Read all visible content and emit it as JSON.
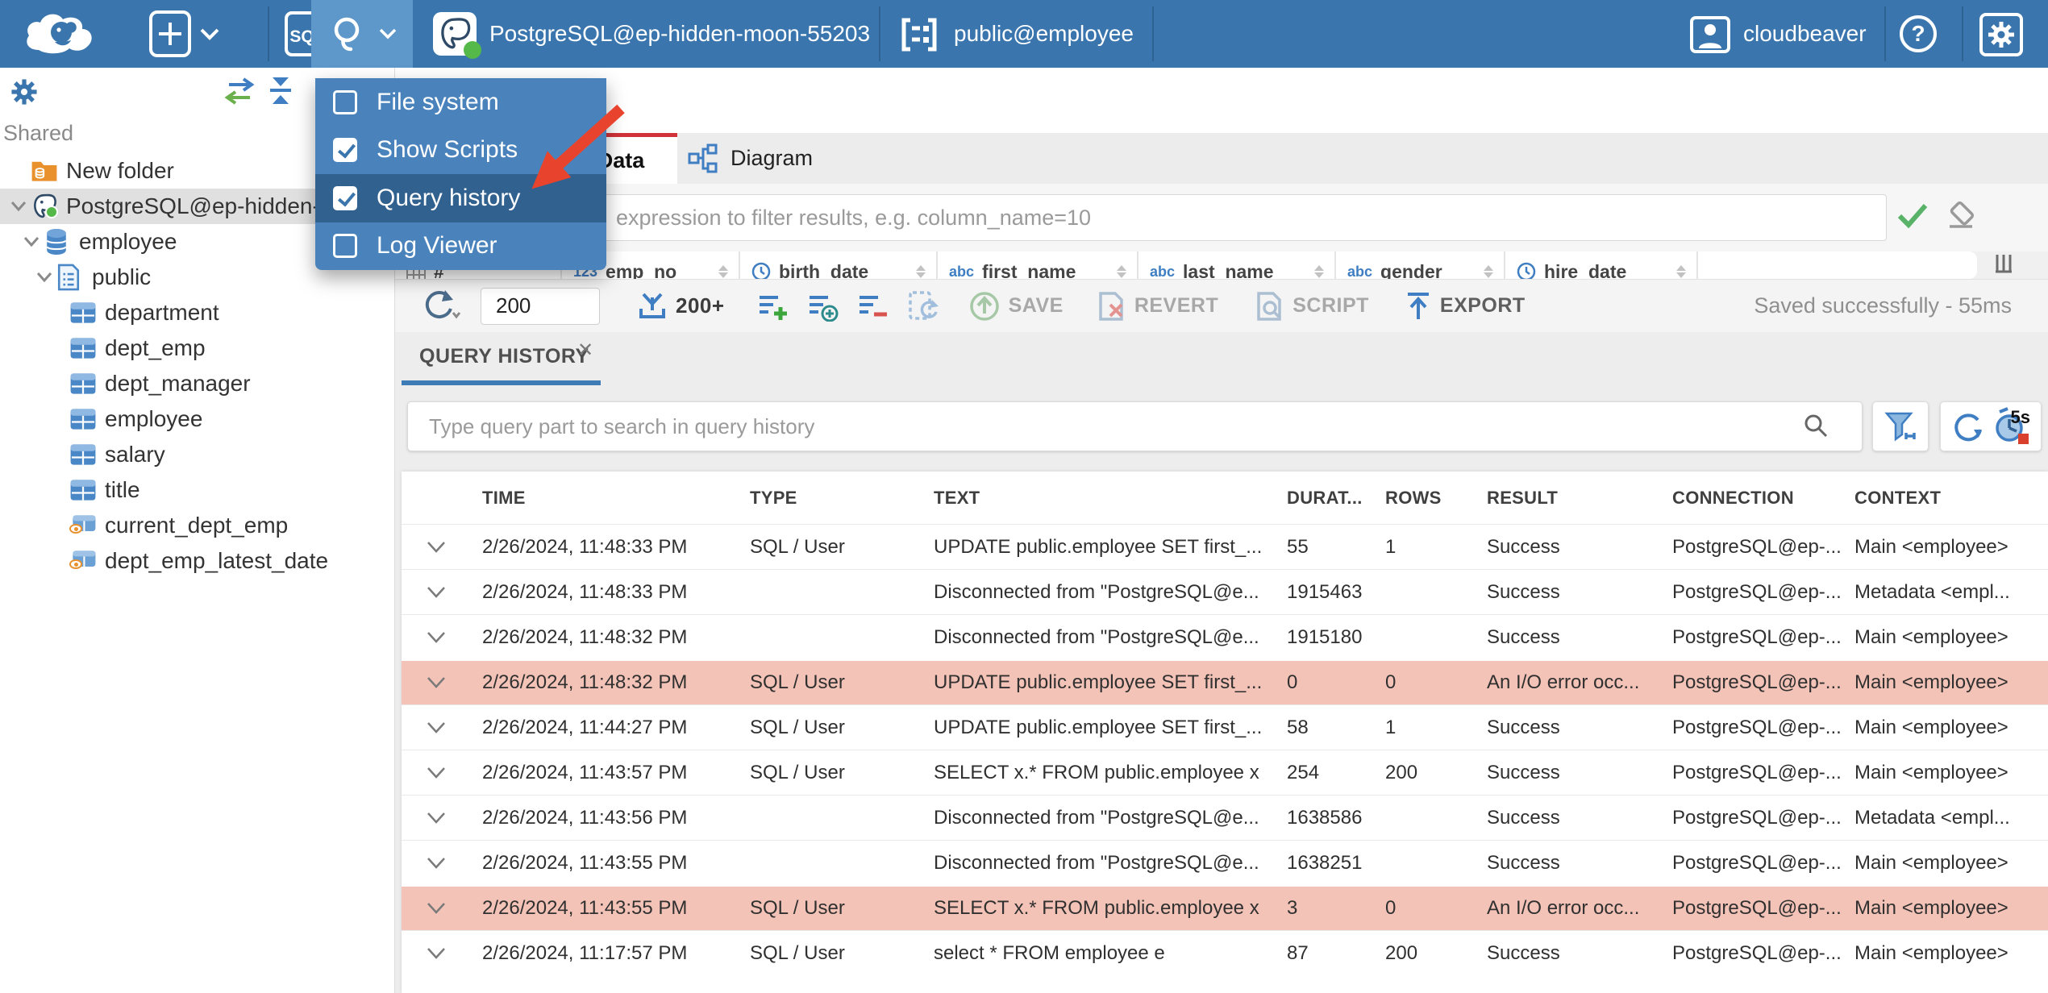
{
  "topbar": {
    "connection_name": "PostgreSQL@ep-hidden-moon-55203",
    "schema_name": "public@employee",
    "sql_label": "SQL",
    "user_name": "cloudbeaver"
  },
  "tools_menu": {
    "items": [
      {
        "label": "File system",
        "checked": false,
        "highlighted": false
      },
      {
        "label": "Show Scripts",
        "checked": true,
        "highlighted": false
      },
      {
        "label": "Query history",
        "checked": true,
        "highlighted": true
      },
      {
        "label": "Log Viewer",
        "checked": false,
        "highlighted": false
      }
    ]
  },
  "sidebar": {
    "section_label": "Shared",
    "tree": [
      {
        "label": "New folder",
        "icon": "folder",
        "level": 1,
        "chevron": false,
        "selected": false
      },
      {
        "label": "PostgreSQL@ep-hidden-",
        "icon": "postgres",
        "level": 1,
        "chevron": true,
        "selected": true
      },
      {
        "label": "employee",
        "icon": "database",
        "level": 2,
        "chevron": true,
        "selected": false
      },
      {
        "label": "public",
        "icon": "schema",
        "level": 3,
        "chevron": true,
        "selected": false
      },
      {
        "label": "department",
        "icon": "table",
        "level": 4,
        "chevron": false,
        "selected": false
      },
      {
        "label": "dept_emp",
        "icon": "table",
        "level": 4,
        "chevron": false,
        "selected": false
      },
      {
        "label": "dept_manager",
        "icon": "table",
        "level": 4,
        "chevron": false,
        "selected": false
      },
      {
        "label": "employee",
        "icon": "table",
        "level": 4,
        "chevron": false,
        "selected": false
      },
      {
        "label": "salary",
        "icon": "table",
        "level": 4,
        "chevron": false,
        "selected": false
      },
      {
        "label": "title",
        "icon": "table",
        "level": 4,
        "chevron": false,
        "selected": false
      },
      {
        "label": "current_dept_emp",
        "icon": "view",
        "level": 4,
        "chevron": false,
        "selected": false
      },
      {
        "label": "dept_emp_latest_date",
        "icon": "view",
        "level": 4,
        "chevron": false,
        "selected": false
      }
    ]
  },
  "main": {
    "tabs": [
      {
        "label": "Data",
        "active": true
      },
      {
        "label": "Diagram",
        "active": false
      }
    ],
    "filter_placeholder": "expression to filter results, e.g. column_name=10",
    "grid_columns": [
      {
        "glyph": "rownum",
        "label": "#"
      },
      {
        "glyph": "123",
        "label": "emp_no"
      },
      {
        "glyph": "clock",
        "label": "birth_date"
      },
      {
        "glyph": "abc",
        "label": "first_name"
      },
      {
        "glyph": "abc",
        "label": "last_name"
      },
      {
        "glyph": "abc",
        "label": "gender"
      },
      {
        "glyph": "clock",
        "label": "hire_date"
      }
    ],
    "toolbar": {
      "row_limit": "200",
      "fetch_label": "200+",
      "save_label": "SAVE",
      "revert_label": "REVERT",
      "script_label": "SCRIPT",
      "export_label": "EXPORT",
      "status": "Saved successfully - 55ms"
    }
  },
  "query_history": {
    "tab_label": "QUERY HISTORY",
    "search_placeholder": "Type query part to search in query history",
    "refresh_interval": "5s",
    "columns": [
      "TIME",
      "TYPE",
      "TEXT",
      "DURAT...",
      "ROWS",
      "RESULT",
      "CONNECTION",
      "CONTEXT"
    ],
    "rows": [
      {
        "time": "2/26/2024, 11:48:33 PM",
        "type": "SQL / User",
        "text": "UPDATE public.employee SET first_...",
        "duration": "55",
        "rows": "1",
        "result": "Success",
        "connection": "PostgreSQL@ep-...",
        "context": "Main <employee>",
        "error": false
      },
      {
        "time": "2/26/2024, 11:48:33 PM",
        "type": "",
        "text": "Disconnected from \"PostgreSQL@e...",
        "duration": "1915463",
        "rows": "",
        "result": "Success",
        "connection": "PostgreSQL@ep-...",
        "context": "Metadata <empl...",
        "error": false
      },
      {
        "time": "2/26/2024, 11:48:32 PM",
        "type": "",
        "text": "Disconnected from \"PostgreSQL@e...",
        "duration": "1915180",
        "rows": "",
        "result": "Success",
        "connection": "PostgreSQL@ep-...",
        "context": "Main <employee>",
        "error": false
      },
      {
        "time": "2/26/2024, 11:48:32 PM",
        "type": "SQL / User",
        "text": "UPDATE public.employee SET first_...",
        "duration": "0",
        "rows": "0",
        "result": "An I/O error occ...",
        "connection": "PostgreSQL@ep-...",
        "context": "Main <employee>",
        "error": true
      },
      {
        "time": "2/26/2024, 11:44:27 PM",
        "type": "SQL / User",
        "text": "UPDATE public.employee SET first_...",
        "duration": "58",
        "rows": "1",
        "result": "Success",
        "connection": "PostgreSQL@ep-...",
        "context": "Main <employee>",
        "error": false
      },
      {
        "time": "2/26/2024, 11:43:57 PM",
        "type": "SQL / User",
        "text": "SELECT x.* FROM public.employee x",
        "duration": "254",
        "rows": "200",
        "result": "Success",
        "connection": "PostgreSQL@ep-...",
        "context": "Main <employee>",
        "error": false
      },
      {
        "time": "2/26/2024, 11:43:56 PM",
        "type": "",
        "text": "Disconnected from \"PostgreSQL@e...",
        "duration": "1638586",
        "rows": "",
        "result": "Success",
        "connection": "PostgreSQL@ep-...",
        "context": "Metadata <empl...",
        "error": false
      },
      {
        "time": "2/26/2024, 11:43:55 PM",
        "type": "",
        "text": "Disconnected from \"PostgreSQL@e...",
        "duration": "1638251",
        "rows": "",
        "result": "Success",
        "connection": "PostgreSQL@ep-...",
        "context": "Main <employee>",
        "error": false
      },
      {
        "time": "2/26/2024, 11:43:55 PM",
        "type": "SQL / User",
        "text": "SELECT x.* FROM public.employee x",
        "duration": "3",
        "rows": "0",
        "result": "An I/O error occ...",
        "connection": "PostgreSQL@ep-...",
        "context": "Main <employee>",
        "error": true
      },
      {
        "time": "2/26/2024, 11:17:57 PM",
        "type": "SQL / User",
        "text": "select * FROM employee e",
        "duration": "87",
        "rows": "200",
        "result": "Success",
        "connection": "PostgreSQL@ep-...",
        "context": "Main <employee>",
        "error": false
      }
    ]
  }
}
